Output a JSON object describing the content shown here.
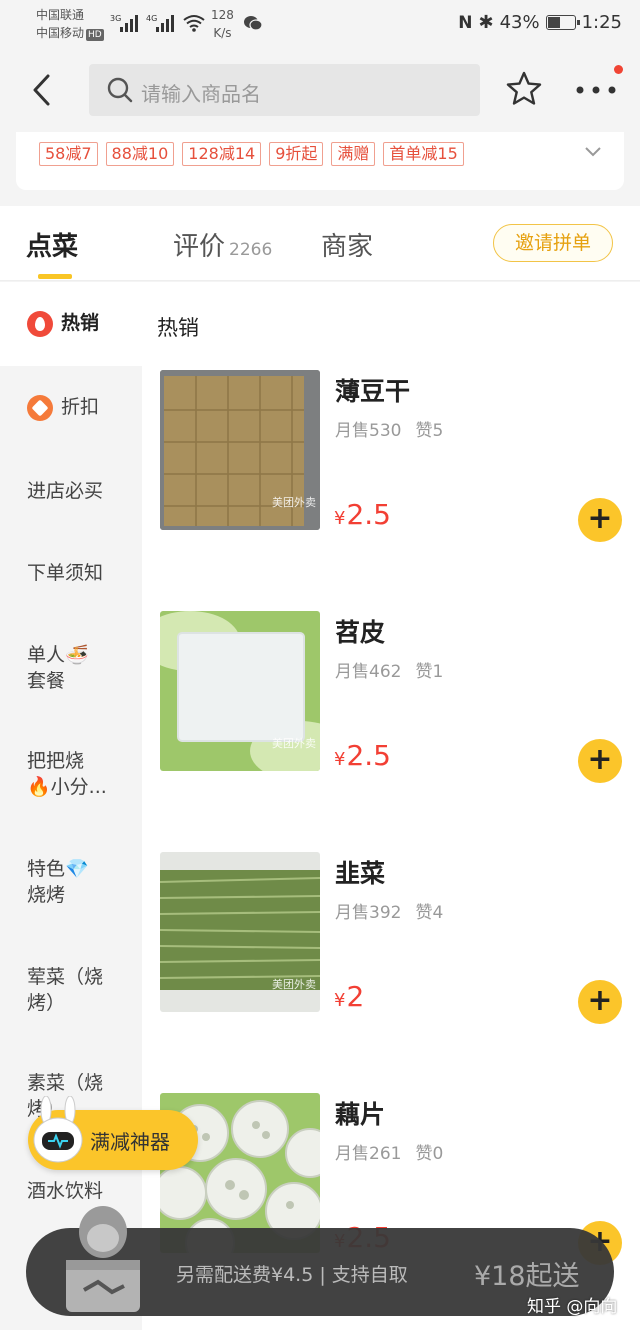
{
  "status_bar": {
    "carrier1": "中国联通",
    "carrier2": "中国移动",
    "hd": "HD",
    "net1": "3G",
    "net2": "4G",
    "speed_value": "128",
    "speed_unit": "K/s",
    "battery": "43%",
    "time": "1:25"
  },
  "header": {
    "search_placeholder": "请输入商品名"
  },
  "discounts": [
    "58减7",
    "88减10",
    "128减14",
    "9折起",
    "满赠",
    "首单减15"
  ],
  "tabs": {
    "order": "点菜",
    "review": "评价",
    "review_count": "2266",
    "shop": "商家",
    "invite": "邀请拼单"
  },
  "sidebar": {
    "items": [
      {
        "label": "热销"
      },
      {
        "label": "折扣"
      },
      {
        "label": "进店必买"
      },
      {
        "label": "下单须知"
      },
      {
        "line1": "单人🍜",
        "line2": "套餐"
      },
      {
        "line1": "把把烧",
        "line2": "🔥小分..."
      },
      {
        "line1": "特色💎",
        "line2": "烧烤"
      },
      {
        "line1": "荤菜（烧",
        "line2": "烤）"
      },
      {
        "line1": "素菜（烧",
        "line2": "烤）"
      },
      {
        "label": "酒水饮料"
      }
    ]
  },
  "content": {
    "section_title": "热销",
    "items": [
      {
        "name": "薄豆干",
        "sales": "月售530",
        "likes": "赞5",
        "currency": "¥",
        "price": "2.5",
        "color": "#a58a5a"
      },
      {
        "name": "苕皮",
        "sales": "月售462",
        "likes": "赞1",
        "currency": "¥",
        "price": "2.5",
        "color": "#e9eef0"
      },
      {
        "name": "韭菜",
        "sales": "月售392",
        "likes": "赞4",
        "currency": "¥",
        "price": "2",
        "color": "#7f9656"
      },
      {
        "name": "藕片",
        "sales": "月售261",
        "likes": "赞0",
        "currency": "¥",
        "price": "2.5",
        "color": "#e8ece6"
      }
    ],
    "watermark": "美团外卖"
  },
  "promo_badge": "满减神器",
  "cart": {
    "info": "另需配送费¥4.5 | 支持自取",
    "min_order": "¥18起送"
  },
  "watermark_footer": "知乎 @向向"
}
